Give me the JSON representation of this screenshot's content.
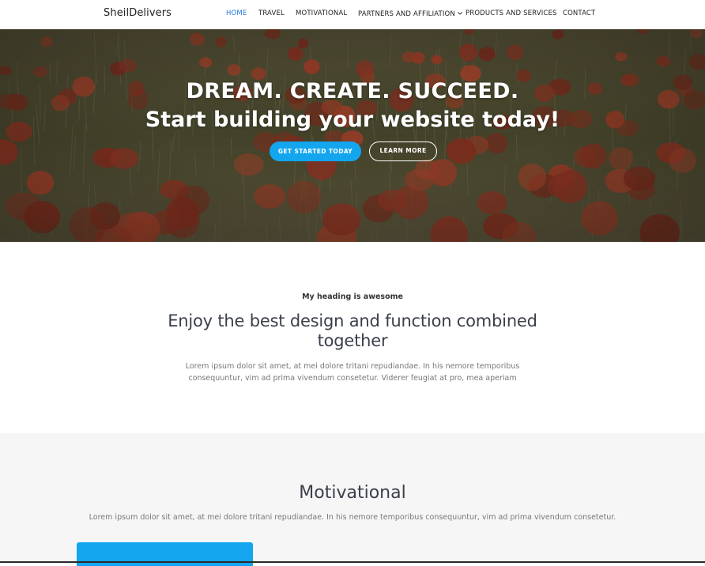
{
  "header": {
    "brand": "SheilDelivers",
    "nav": [
      {
        "label": "HOME",
        "active": true
      },
      {
        "label": "TRAVEL",
        "active": false
      },
      {
        "label": "MOTIVATIONAL",
        "active": false
      },
      {
        "label": "PARTNERS AND AFFILIATION",
        "active": false,
        "has_dropdown": true
      },
      {
        "label": "PRODUCTS AND SERVICES",
        "active": false
      },
      {
        "label": "CONTACT",
        "active": false
      }
    ],
    "dropdown_icon": "chevron-down-icon"
  },
  "hero": {
    "title": "DREAM. CREATE. SUCCEED.",
    "subtitle": "Start building your website today!",
    "primary_button": "GET STARTED TODAY",
    "secondary_button": "LEARN MORE",
    "background": "poppy field photo"
  },
  "intro": {
    "kicker": "My heading is awesome",
    "heading": "Enjoy the best design and function combined together",
    "text": "Lorem ipsum dolor sit amet, at mei dolore tritani repudiandae. In his nemore temporibus consequuntur, vim ad prima vivendum consetetur. Viderer feugiat at pro, mea aperiam"
  },
  "motivational": {
    "heading": "Motivational",
    "text": "Lorem ipsum dolor sit amet, at mei dolore tritani repudiandae. In his nemore temporibus consequuntur, vim ad prima vivendum consetetur."
  },
  "colors": {
    "accent": "#13a6ef",
    "nav_active": "#1f7ad9",
    "text_dark": "#3a3f4a",
    "text_muted": "#777777",
    "section_alt_bg": "#f6f6f6"
  }
}
